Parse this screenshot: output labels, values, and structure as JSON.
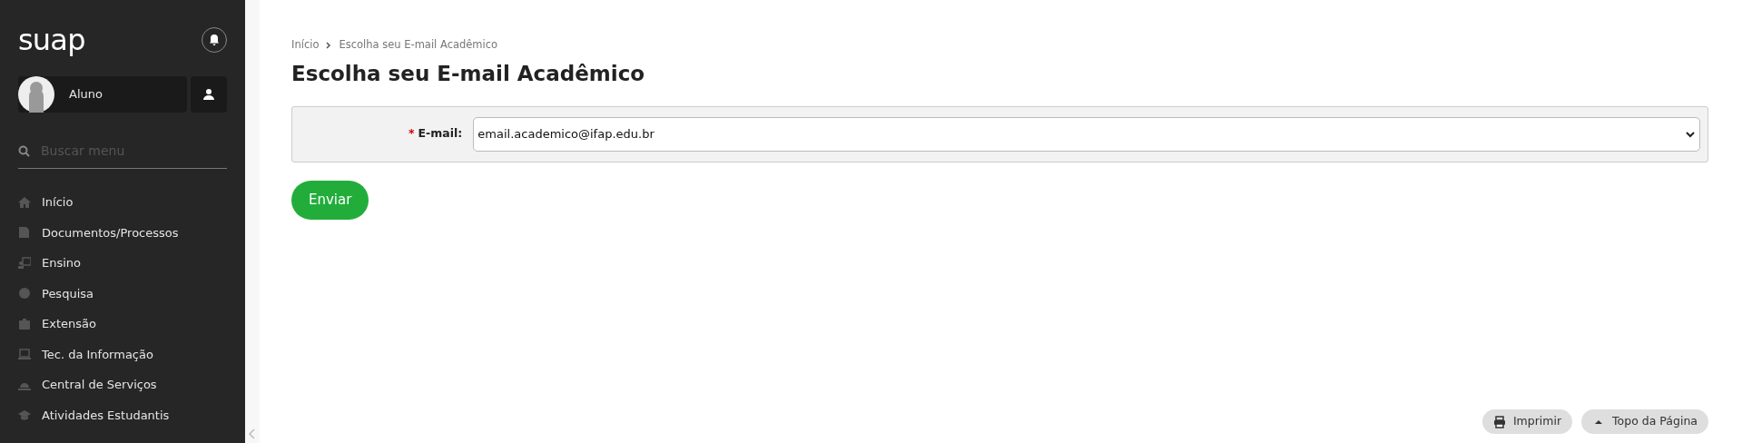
{
  "sidebar": {
    "logo": "suap",
    "user": {
      "name": "Aluno"
    },
    "search": {
      "placeholder": "Buscar menu"
    },
    "items": [
      {
        "label": "Início"
      },
      {
        "label": "Documentos/Processos"
      },
      {
        "label": "Ensino"
      },
      {
        "label": "Pesquisa"
      },
      {
        "label": "Extensão"
      },
      {
        "label": "Tec. da Informação"
      },
      {
        "label": "Central de Serviços"
      },
      {
        "label": "Atividades Estudantis"
      }
    ]
  },
  "breadcrumb": [
    "Início",
    "Escolha seu E-mail Acadêmico"
  ],
  "title": "Escolha seu E-mail Acadêmico",
  "form": {
    "label": "E-mail:",
    "required_mark": "*",
    "value": "email.academico@ifap.edu.br"
  },
  "submit": "Enviar",
  "footer_buttons": [
    {
      "label": "Imprimir"
    },
    {
      "label": "Topo da Página"
    }
  ]
}
